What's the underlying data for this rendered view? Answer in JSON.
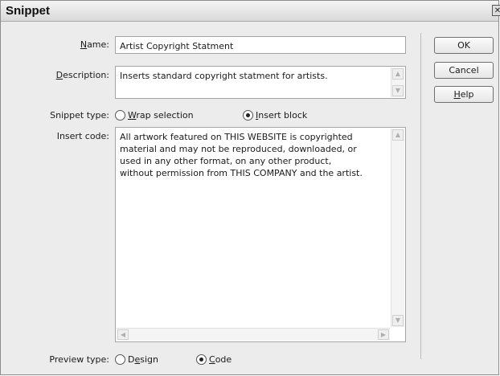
{
  "window": {
    "title": "Snippet",
    "close_glyph": "✕"
  },
  "form": {
    "name": {
      "label_prefix": "",
      "label_mnemonic": "N",
      "label_rest": "ame:",
      "value": "Artist Copyright Statment"
    },
    "description": {
      "label_prefix": "",
      "label_mnemonic": "D",
      "label_rest": "escription:",
      "value": "Inserts standard copyright statment for artists."
    },
    "snippet_type": {
      "label": "Snippet type:",
      "options": [
        {
          "prefix": "",
          "mnemonic": "W",
          "rest": "rap selection",
          "selected": false
        },
        {
          "prefix": "",
          "mnemonic": "I",
          "rest": "nsert block",
          "selected": true
        }
      ]
    },
    "insert_code": {
      "label": "Insert code:",
      "value": "All artwork featured on THIS WEBSITE is copyrighted\nmaterial and may not be reproduced, downloaded, or\nused in any other format, on any other product,\nwithout permission from THIS COMPANY and the artist."
    },
    "preview_type": {
      "label": "Preview type:",
      "options": [
        {
          "prefix": "D",
          "mnemonic": "e",
          "rest": "sign",
          "selected": false
        },
        {
          "prefix": "",
          "mnemonic": "C",
          "rest": "ode",
          "selected": true
        }
      ]
    }
  },
  "buttons": {
    "ok": "OK",
    "cancel": "Cancel",
    "help": {
      "prefix": "",
      "mnemonic": "H",
      "rest": "elp"
    }
  },
  "icons": {
    "scroll_up": "▲",
    "scroll_down": "▼",
    "scroll_left": "◀",
    "scroll_right": "▶"
  }
}
